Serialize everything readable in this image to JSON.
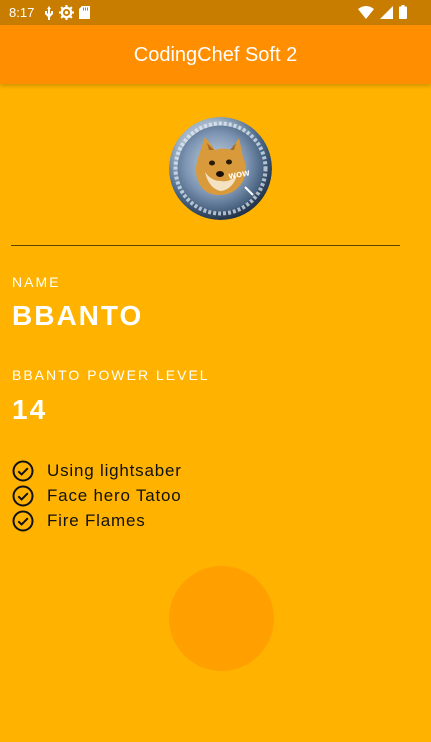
{
  "status_bar": {
    "time": "8:17",
    "left_icons": [
      "usb-icon",
      "settings-icon",
      "sd-card-icon"
    ],
    "right_icons": [
      "wifi-icon",
      "signal-icon",
      "battery-icon"
    ]
  },
  "app_bar": {
    "title": "CodingChef Soft 2"
  },
  "profile": {
    "avatar_icon": "doge-coin-avatar",
    "name_label": "NAME",
    "name_value": "BBANTO",
    "power_label": "BBANTO POWER LEVEL",
    "power_value": "14"
  },
  "skills": [
    {
      "label": "Using lightsaber",
      "icon": "check-circle-icon"
    },
    {
      "label": "Face hero Tatoo",
      "icon": "check-circle-icon"
    },
    {
      "label": "Fire Flames",
      "icon": "check-circle-icon"
    }
  ],
  "colors": {
    "background": "#ffb300",
    "app_bar": "#ff8f00",
    "status_bar": "#c97d00",
    "text_light": "#ffffff",
    "text_dark": "#111111",
    "divider": "#5b4400",
    "ink": "#ffa000"
  }
}
